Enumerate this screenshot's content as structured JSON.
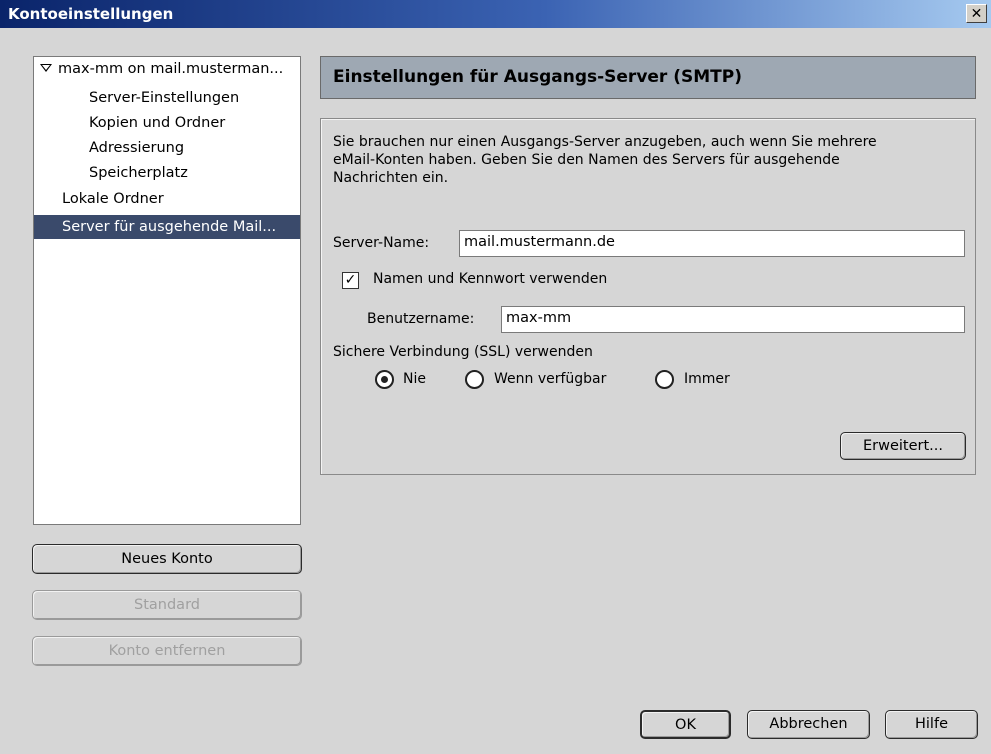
{
  "window": {
    "title": "Kontoeinstellungen",
    "close_glyph": "✕"
  },
  "tree": {
    "account": "max-mm on mail.musterman...",
    "children": [
      "Server-Einstellungen",
      "Kopien und Ordner",
      "Adressierung",
      "Speicherplatz"
    ],
    "local_folders": "Lokale Ordner",
    "outgoing": "Server für ausgehende Mail..."
  },
  "left_buttons": {
    "new_account": "Neues Konto",
    "default": "Standard",
    "remove": "Konto entfernen"
  },
  "panel": {
    "header": "Einstellungen für Ausgangs-Server (SMTP)",
    "desc_lines": [
      "Sie brauchen nur einen Ausgangs-Server anzugeben, auch wenn Sie mehrere",
      "eMail-Konten haben. Geben Sie den Namen des Servers für ausgehende",
      "Nachrichten ein."
    ],
    "server_name_label": "Server-Name:",
    "server_name_value": "mail.mustermann.de",
    "use_auth_label": "Namen und Kennwort verwenden",
    "use_auth_checked": true,
    "check_glyph": "✓",
    "username_label": "Benutzername:",
    "username_value": "max-mm",
    "ssl_label": "Sichere Verbindung (SSL) verwenden",
    "ssl_options": [
      "Nie",
      "Wenn verfügbar",
      "Immer"
    ],
    "ssl_selected": "Nie",
    "advanced": "Erweitert..."
  },
  "footer": {
    "ok": "OK",
    "cancel": "Abbrechen",
    "help": "Hilfe"
  }
}
